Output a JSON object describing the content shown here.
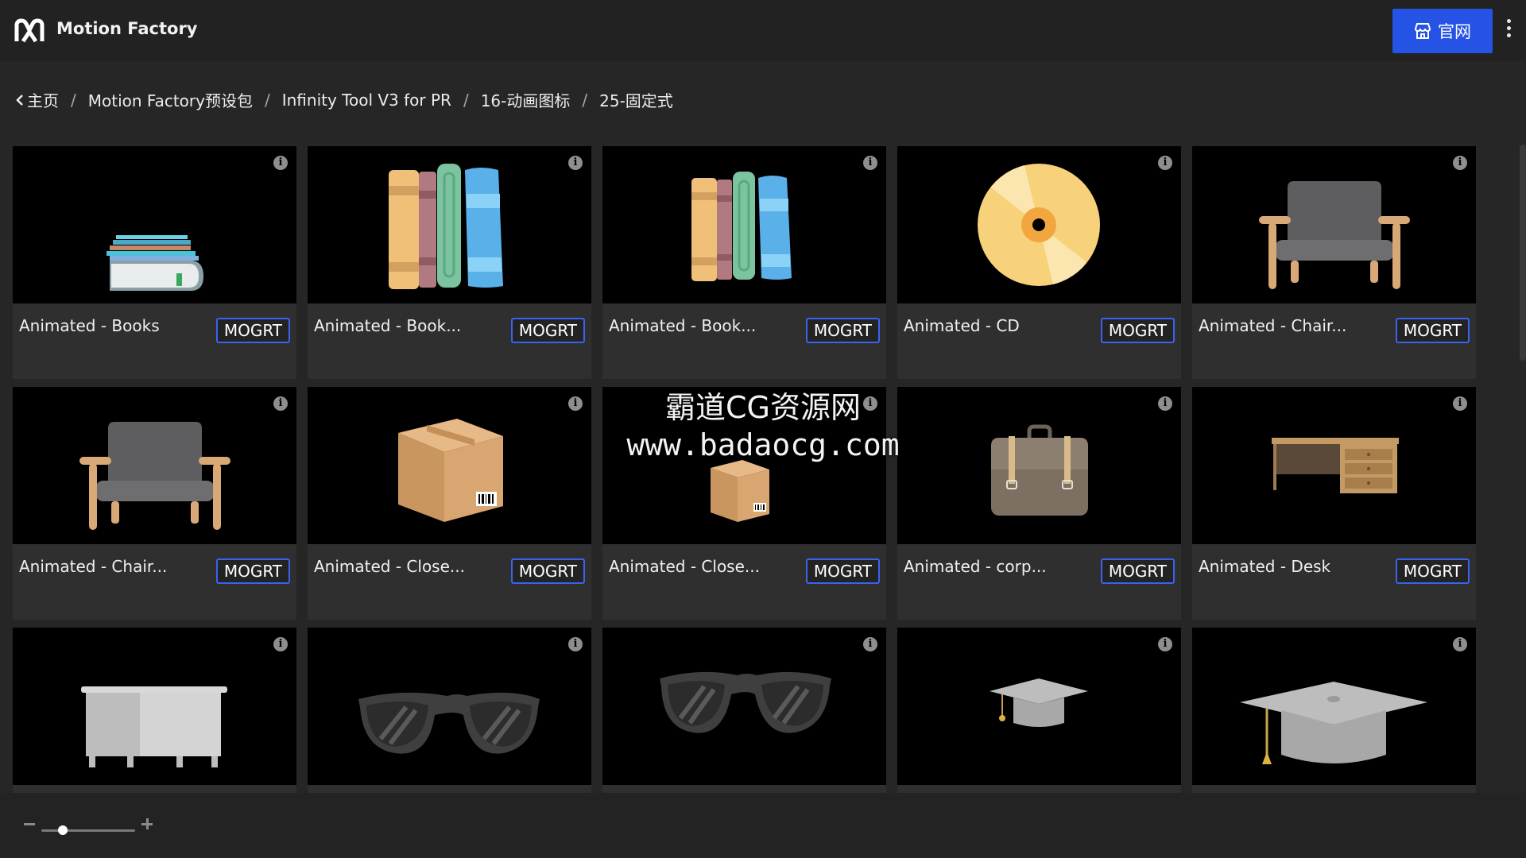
{
  "app": {
    "title": "Motion Factory",
    "site_button_label": "官网"
  },
  "breadcrumb": [
    "主页",
    "Motion Factory预设包",
    "Infinity Tool V3 for PR",
    "16-动画图标",
    "25-固定式"
  ],
  "items": [
    {
      "title": "Animated - Books",
      "badge": "MOGRT",
      "icon": "books-stack-icon"
    },
    {
      "title": "Animated - Book...",
      "badge": "MOGRT",
      "icon": "books-upright-large-icon"
    },
    {
      "title": "Animated - Book...",
      "badge": "MOGRT",
      "icon": "books-upright-icon"
    },
    {
      "title": "Animated - CD",
      "badge": "MOGRT",
      "icon": "cd-icon"
    },
    {
      "title": "Animated - Chair...",
      "badge": "MOGRT",
      "icon": "chair-icon"
    },
    {
      "title": "Animated - Chair...",
      "badge": "MOGRT",
      "icon": "chair-icon"
    },
    {
      "title": "Animated - Close...",
      "badge": "MOGRT",
      "icon": "box-large-icon"
    },
    {
      "title": "Animated - Close...",
      "badge": "MOGRT",
      "icon": "box-small-icon"
    },
    {
      "title": "Animated - corp...",
      "badge": "MOGRT",
      "icon": "briefcase-icon"
    },
    {
      "title": "Animated - Desk",
      "badge": "MOGRT",
      "icon": "desk-icon"
    },
    {
      "title": "",
      "badge": "",
      "icon": "table-icon"
    },
    {
      "title": "",
      "badge": "",
      "icon": "sunglasses-icon"
    },
    {
      "title": "",
      "badge": "",
      "icon": "sunglasses-icon"
    },
    {
      "title": "",
      "badge": "",
      "icon": "grad-cap-small-icon"
    },
    {
      "title": "",
      "badge": "",
      "icon": "grad-cap-large-icon"
    }
  ],
  "watermark": {
    "line1": "霸道CG资源网",
    "line2": "www.badaocg.com"
  },
  "colors": {
    "accent": "#2553e6",
    "badge_border": "#3a63f0",
    "background": "#262626",
    "topbar": "#222222"
  }
}
